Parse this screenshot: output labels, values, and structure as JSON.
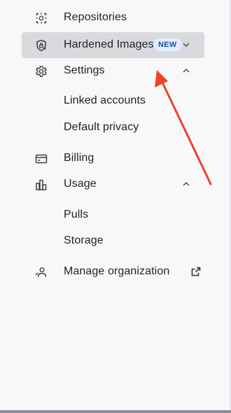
{
  "nav": {
    "items": [
      {
        "label": "Repositories",
        "icon": "repositories-icon"
      },
      {
        "label": "Hardened Images",
        "icon": "shield-lock-icon",
        "badge": "NEW",
        "expanded": false,
        "active": true
      },
      {
        "label": "Settings",
        "icon": "gear-icon",
        "expanded": true
      },
      {
        "label": "Linked accounts"
      },
      {
        "label": "Default privacy"
      },
      {
        "label": "Billing",
        "icon": "credit-card-icon"
      },
      {
        "label": "Usage",
        "icon": "bar-chart-icon",
        "expanded": true
      },
      {
        "label": "Pulls"
      },
      {
        "label": "Storage"
      },
      {
        "label": "Manage organization",
        "icon": "users-icon",
        "external": true
      }
    ]
  },
  "colors": {
    "active_background": "#d9dadd",
    "badge_background": "#e3ecfb",
    "badge_text": "#1b4fa8",
    "annotation_arrow": "#e8452c"
  }
}
